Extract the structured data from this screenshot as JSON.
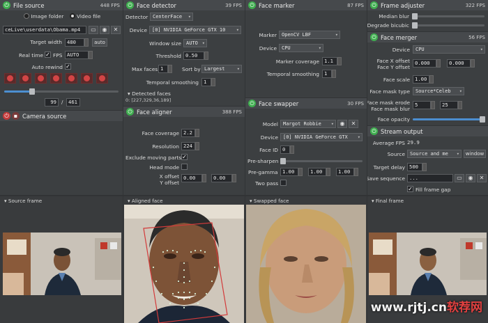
{
  "file_source": {
    "title": "File source",
    "fps": "448 FPS",
    "mode_image": "Image folder",
    "mode_video": "Video file",
    "path": "ceLive\\userdata\\Obama.mp4",
    "target_width_label": "Target width",
    "target_width": "480",
    "auto_btn": "auto",
    "realtime_label": "Real time",
    "fps_label": "FPS",
    "fps_value": "AUTO",
    "auto_rewind_label": "Auto rewind",
    "frame_current": "99",
    "frame_sep": "/",
    "frame_total": "461"
  },
  "camera_source": {
    "title": "Camera source"
  },
  "face_detector": {
    "title": "Face detector",
    "fps": "39 FPS",
    "detector_label": "Detector",
    "detector": "CenterFace",
    "device_label": "Device",
    "device": "[0] NVIDIA GeForce GTX 10",
    "window_size_label": "Window size",
    "window_size": "AUTO",
    "threshold_label": "Threshold",
    "threshold": "0.50",
    "max_faces_label": "Max faces",
    "max_faces": "1",
    "sort_by_label": "Sort by",
    "sort_by": "Largest",
    "temporal_label": "Temporal smoothing",
    "temporal": "1",
    "detected_label": "Detected faces",
    "detected_value": "0: [227,329,36,189]"
  },
  "face_aligner": {
    "title": "Face aligner",
    "fps": "388 FPS",
    "coverage_label": "Face coverage",
    "coverage": "2.2",
    "resolution_label": "Resolution",
    "resolution": "224",
    "exclude_label": "Exclude moving parts",
    "head_mode_label": "Head mode",
    "x_offset_label": "X offset",
    "y_offset_label": "Y offset",
    "x_offset": "0.00",
    "y_offset": "0.00"
  },
  "face_marker": {
    "title": "Face marker",
    "fps": "87 FPS",
    "marker_label": "Marker",
    "marker": "OpenCV LBF",
    "device_label": "Device",
    "device": "CPU",
    "coverage_label": "Marker coverage",
    "coverage": "1.1",
    "temporal_label": "Temporal smoothing",
    "temporal": "1"
  },
  "face_swapper": {
    "title": "Face swapper",
    "fps": "30 FPS",
    "model_label": "Model",
    "model": "Margot Robbie",
    "device_label": "Device",
    "device": "[0] NVIDIA GeForce GTX",
    "face_id_label": "Face ID",
    "face_id": "0",
    "pre_sharpen_label": "Pre-sharpen",
    "pre_gamma_label": "Pre-gamma",
    "gamma_r": "1.00",
    "gamma_g": "1.00",
    "gamma_b": "1.00",
    "two_pass_label": "Two pass"
  },
  "frame_adjuster": {
    "title": "Frame adjuster",
    "fps": "322 FPS",
    "median_label": "Median blur",
    "degrade_label": "Degrade bicubic"
  },
  "face_merger": {
    "title": "Face merger",
    "fps": "56 FPS",
    "device_label": "Device",
    "device": "CPU",
    "x_offset_label": "Face X offset",
    "y_offset_label": "Face Y offset",
    "x_offset": "0.000",
    "y_offset": "0.000",
    "scale_label": "Face scale",
    "scale": "1.00",
    "mask_type_label": "Face mask type",
    "mask_type": "Source*Celeb",
    "erode_label": "Face mask erode",
    "blur_label": "Face mask blur",
    "erode": "5",
    "blur": "25",
    "opacity_label": "Face opacity"
  },
  "stream_output": {
    "title": "Stream output",
    "avg_fps_label": "Average FPS",
    "avg_fps": "29.9",
    "source_label": "Source",
    "source": "Source and me",
    "window_btn": "window",
    "delay_label": "Target delay",
    "delay": "500",
    "save_label": "Save sequence",
    "save_path": "...",
    "fill_gap_label": "Fill frame gap"
  },
  "previews": {
    "source": "Source frame",
    "aligned": "Aligned face",
    "swapped": "Swapped face",
    "final": "Final frame"
  },
  "watermark": {
    "prefix": "www.rjtj.cn",
    "suffix": "软荐网"
  },
  "colors": {
    "panel": "#3c3f41",
    "header": "#46494c",
    "power_on": "#3fae4f",
    "power_off": "#c53a3a",
    "accent": "#4c8fd1"
  }
}
